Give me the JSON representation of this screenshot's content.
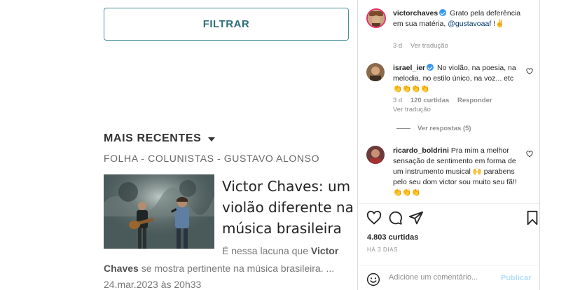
{
  "news": {
    "filter_button": "FILTRAR",
    "section_title": "MAIS RECENTES",
    "breadcrumb": "FOLHA - COLUNISTAS - GUSTAVO ALONSO",
    "article": {
      "headline": "Victor Chaves: um violão diferente na música brasileira",
      "excerpt_a": "É nessa lacuna que ",
      "excerpt_b": "Victor",
      "excerpt_c": "Chaves",
      "excerpt_d": " se mostra pertinente na música brasileira. ...",
      "date": "24.mar.2023 às 20h33"
    }
  },
  "instagram": {
    "comments": [
      {
        "username": "victorchaves",
        "verified": true,
        "text_before": "Grato pela deferência em sua matéria, ",
        "mention": "@gustavoaaf",
        "text_after": " !✌️",
        "age": "3 d",
        "translate": "Ver tradução"
      },
      {
        "username": "israel_ier",
        "verified": true,
        "text": "No violão, na poesia, na melodia, no estilo único, na voz... etc 👏👏👏👏",
        "age": "3 d",
        "likes": "120 curtidas",
        "reply": "Responder",
        "translate": "Ver tradução",
        "view_replies": "Ver respostas (5)"
      },
      {
        "username": "ricardo_boldrini",
        "verified": false,
        "text": "Pra mim a melhor sensação de sentimento em forma de um instrumento musical 🙌 parabens pelo seu dom victor sou muito seu fã!!👏👏👏"
      }
    ],
    "likes_count": "4.803 curtidas",
    "posted_ago": "HÁ 3 DIAS",
    "comment_placeholder": "Adicione um comentário...",
    "publish_label": "Publicar",
    "colors": {
      "verified": "#3897f0",
      "mention": "#00376b",
      "publish_disabled": "#b2dffc",
      "filter_border": "#4b8f9a"
    }
  }
}
